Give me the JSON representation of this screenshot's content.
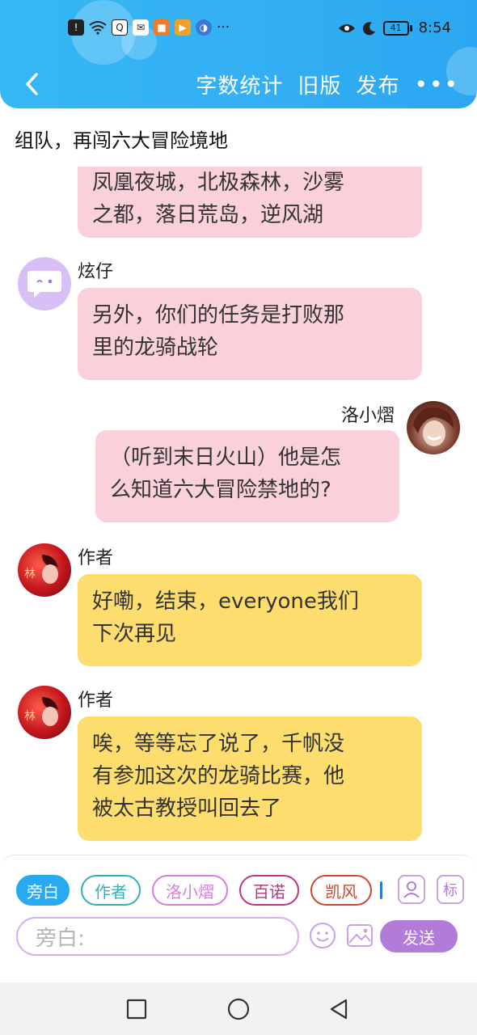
{
  "status_bar": {
    "time": "8:54",
    "battery": "41",
    "more": "···"
  },
  "header": {
    "actions": [
      "字数统计",
      "旧版",
      "发布"
    ],
    "more": "•••",
    "accent": "#33aef3"
  },
  "page": {
    "title": "组队，再闯六大冒险境地"
  },
  "messages": [
    {
      "speaker": "",
      "side": "left",
      "color": "pink",
      "text_lines": [
        "凤凰夜城，北极森林，沙雾",
        "之都，落日荒岛，逆风湖"
      ]
    },
    {
      "speaker": "炫仔",
      "side": "left",
      "color": "pink",
      "avatar": "chat-bubble-avatar",
      "text_lines": [
        "另外，你们的任务是打败那",
        "里的龙骑战轮"
      ]
    },
    {
      "speaker": "洛小熠",
      "side": "right",
      "color": "pink",
      "avatar": "character-avatar",
      "text_lines": [
        "（听到末日火山）他是怎",
        "么知道六大冒险禁地的?"
      ]
    },
    {
      "speaker": "作者",
      "side": "left",
      "color": "yellow",
      "avatar": "author-avatar",
      "text_lines": [
        "好嘞，结束，everyone我们",
        "下次再见"
      ]
    },
    {
      "speaker": "作者",
      "side": "left",
      "color": "yellow",
      "avatar": "author-avatar",
      "text_lines": [
        "唉，等等忘了说了，千帆没",
        "有参加这次的龙骑比赛，他",
        "被太古教授叫回去了"
      ]
    }
  ],
  "composer": {
    "roles": [
      "旁白",
      "作者",
      "洛小熠",
      "百诺",
      "凯风"
    ],
    "role_colors": [
      "#29aaf0",
      "#2eb3b8",
      "#d77ce0",
      "#c0357f",
      "#d0472f"
    ],
    "tag_button": "标",
    "input_placeholder": "旁白:",
    "send_label": "发送",
    "send_color": "#b27ad9"
  }
}
